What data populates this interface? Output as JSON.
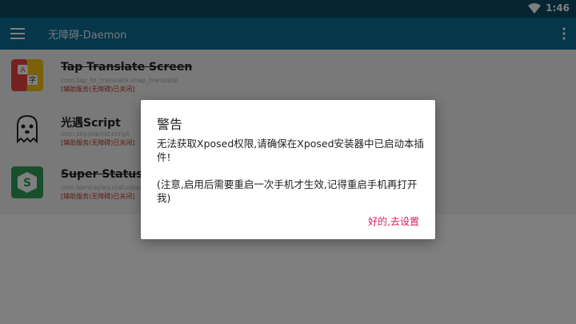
{
  "status_bar": {
    "time": "1:46"
  },
  "app_bar": {
    "title": "无障碍-Daemon"
  },
  "apps": [
    {
      "name": "Tap Translate Screen",
      "package": "com.tap_to_translate.snap_translate",
      "status": "[辅助服务(无障碍)已关闭]",
      "icon": "tap-translate-icon"
    },
    {
      "name": "光遇Script",
      "package": "com.sky.pianist.script",
      "status": "[辅助服务(无障碍)已关闭]",
      "icon": "ghost-icon"
    },
    {
      "name": "Super Status Bar",
      "package": "com.tombayley.statusbar",
      "status": "[辅助服务(无障碍)已关闭]",
      "icon": "super-status-bar-icon"
    }
  ],
  "dialog": {
    "title": "警告",
    "message": "无法获取Xposed权限,请确保在Xposed安装器中已启动本插件!\n\n(注意,启用后需要重启一次手机才生效,记得重启手机再打开我)",
    "positive_button": "好的,去设置"
  },
  "colors": {
    "status_bar": "#0b4a66",
    "app_bar": "#0a6d95",
    "accent": "#d81b60",
    "status_text": "#c0392b"
  }
}
